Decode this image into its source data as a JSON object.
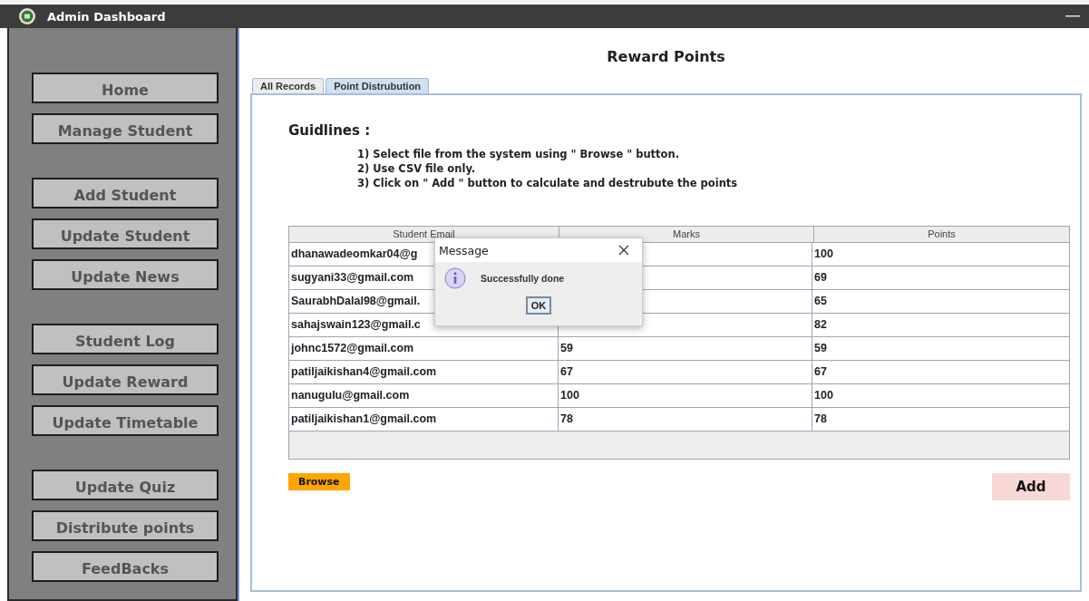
{
  "window": {
    "title": "Admin Dashboard"
  },
  "sidebar": {
    "groups": [
      [
        "Home",
        "Manage Student"
      ],
      [
        "Add Student",
        "Update Student",
        "Update News"
      ],
      [
        "Student Log",
        "Update Reward",
        "Update Timetable"
      ],
      [
        "Update Quiz",
        "Distribute points",
        "FeedBacks"
      ]
    ]
  },
  "page_title": "Reward Points",
  "tabs": [
    {
      "label": "All Records",
      "selected": false
    },
    {
      "label": "Point Distrubution",
      "selected": true
    }
  ],
  "guidelines": {
    "heading": "Guidlines :",
    "items": [
      "1) Select file from the system using \" Browse \" button.",
      "2) Use CSV file only.",
      "3) Click on \" Add \" button to calculate and destrubute the points"
    ]
  },
  "table": {
    "columns": [
      "Student Email",
      "Marks",
      "Points"
    ],
    "rows": [
      {
        "email": "dhanawadeomkar04@g",
        "points": "100"
      },
      {
        "email": "sugyani33@gmail.com",
        "points": "69"
      },
      {
        "email": "SaurabhDalal98@gmail.",
        "points": "65"
      },
      {
        "email": "sahajswain123@gmail.c",
        "points": "82"
      },
      {
        "email": "johnc1572@gmail.com",
        "marks": "59",
        "points": "59"
      },
      {
        "email": "patiljaikishan4@gmail.com",
        "marks": "67",
        "points": "67"
      },
      {
        "email": "nanugulu@gmail.com",
        "marks": "100",
        "points": "100"
      },
      {
        "email": "patiljaikishan1@gmail.com",
        "marks": "78",
        "points": "78"
      }
    ]
  },
  "browse_button": "Browse",
  "add_button": "Add",
  "dialog": {
    "title": "Message",
    "message": "Successfully done",
    "button": "OK"
  }
}
